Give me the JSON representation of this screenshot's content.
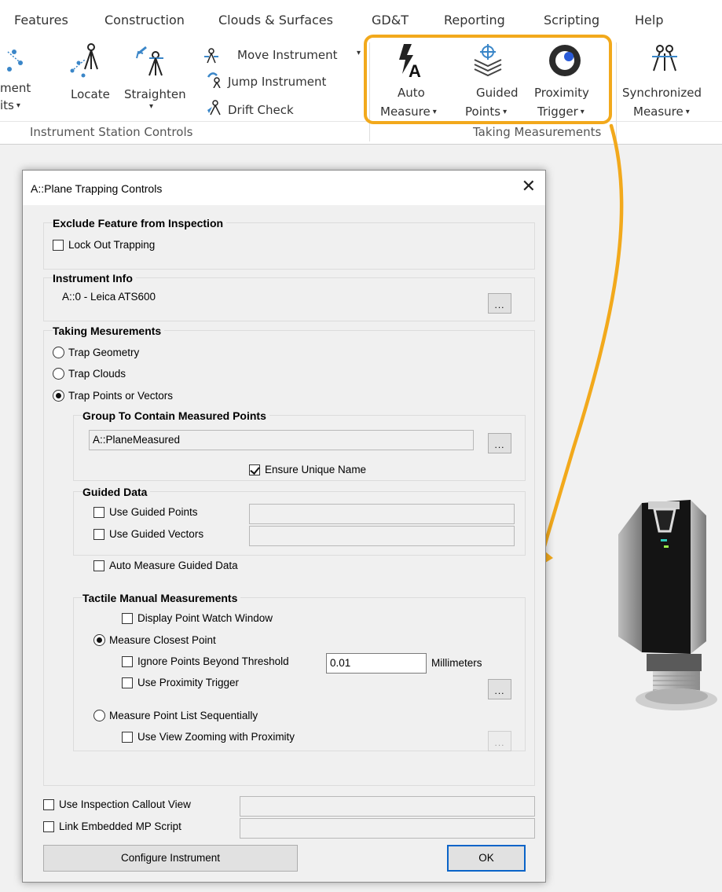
{
  "menu": [
    "Features",
    "Construction",
    "Clouds & Surfaces",
    "GD&T",
    "Reporting",
    "Scripting",
    "Help"
  ],
  "ribbon": {
    "instrument_group": {
      "cut_item_line1": "ment",
      "cut_item_line2": "its",
      "locate_label": "Locate",
      "straighten_label": "Straighten",
      "move_label": "Move Instrument",
      "jump_label": "Jump Instrument",
      "drift_label": "Drift Check",
      "group_label": "Instrument Station Controls"
    },
    "measure_group": {
      "auto_line1": "Auto",
      "auto_line2": "Measure",
      "guided_line1": "Guided",
      "guided_line2": "Points",
      "prox_line1": "Proximity",
      "prox_line2": "Trigger",
      "sync_line1": "Synchronized",
      "sync_line2": "Measure",
      "group_label": "Taking Measurements"
    }
  },
  "colors": {
    "highlight": "#f2a91c",
    "ok_border": "#0a64c8"
  },
  "dialog": {
    "title": "A::Plane Trapping Controls",
    "exclude": {
      "title": "Exclude Feature from Inspection",
      "lock_label": "Lock Out Trapping",
      "lock_checked": false
    },
    "instrument": {
      "title": "Instrument Info",
      "value": "A::0 - Leica ATS600",
      "browse": "..."
    },
    "taking": {
      "title": "Taking Mesurements",
      "trap_geometry": "Trap Geometry",
      "trap_clouds": "Trap Clouds",
      "trap_points": "Trap Points or Vectors",
      "selected": "Trap Points or Vectors",
      "group_contain": {
        "title": "Group To Contain Measured Points",
        "value": "A::PlaneMeasured",
        "browse": "...",
        "unique_label": "Ensure Unique Name",
        "unique_checked": true
      },
      "guided": {
        "title": "Guided Data",
        "points_label": "Use Guided Points",
        "vectors_label": "Use Guided Vectors",
        "points_value": "",
        "vectors_value": ""
      },
      "auto_measure_label": "Auto Measure Guided Data",
      "tactile": {
        "title": "Tactile Manual Measurements",
        "display_watch": "Display Point Watch Window",
        "closest": "Measure Closest Point",
        "ignore_beyond": "Ignore Points Beyond Threshold",
        "threshold_value": "0.01",
        "units": "Millimeters",
        "use_proximity": "Use Proximity Trigger",
        "browse": "...",
        "sequential": "Measure Point List Sequentially",
        "view_zoom": "Use View Zooming with Proximity",
        "browse_disabled": "..."
      }
    },
    "callout_label": "Use Inspection Callout View",
    "callout_value": "",
    "script_label": "Link Embedded MP Script",
    "script_value": "",
    "configure_button": "Configure Instrument",
    "ok_button": "OK"
  }
}
